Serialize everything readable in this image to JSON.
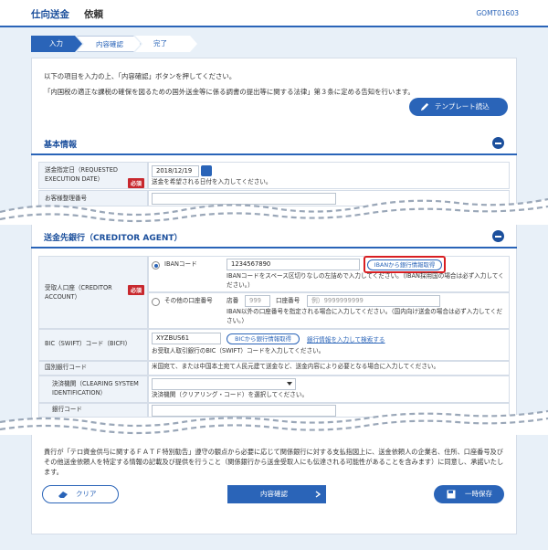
{
  "header": {
    "title": "仕向送金",
    "subtitle": "依頼",
    "screen_code": "GOMT01603"
  },
  "steps": [
    "入力",
    "内容確認",
    "完了"
  ],
  "intro": {
    "line1": "以下の項目を入力の上、「内容確認」ボタンを押してください。",
    "line2": "「内国税の適正な課税の確保を図るための国外送金等に係る調書の提出等に関する法律」第３条に定める告知を行います。"
  },
  "template_button": "テンプレート読込",
  "basic": {
    "title": "基本情報",
    "date_label": "送金指定日（REQUESTED EXECUTION DATE）",
    "required": "必須",
    "date_value": "2018/12/19",
    "date_note": "送金を希望される日付を入力してください。",
    "customer_ref_label": "お客様整理番号"
  },
  "creditor": {
    "title": "送金先銀行（CREDITOR AGENT）",
    "account_label": "受取人口座（CREDITOR ACCOUNT）",
    "required": "必須",
    "iban_radio": "IBANコード",
    "iban_value": "1234567890",
    "iban_lookup": "IBANから銀行情報取得",
    "iban_note": "IBANコードをスペース区切りなしの左詰めで入力してください。（IBAN採用国の場合は必ず入力してください。）",
    "other_radio": "その他の口座番号",
    "branch_label": "店番",
    "branch_placeholder": "999",
    "account_no_label": "口座番号",
    "account_no_placeholder": "例）9999999999",
    "other_note": "IBAN以外の口座番号を指定される場合に入力してください。（国内向け送金の場合は必ず入力してください。）",
    "bic_label": "BIC（SWIFT）コード（BICFI）",
    "bic_value": "XYZBUS61",
    "bic_lookup": "BICから銀行情報取得",
    "bic_search": "銀行情報を入力して検索する",
    "bic_note": "お受取人取引銀行のBIC（SWIFT）コードを入力してください。",
    "domestic_label": "国別銀行コード",
    "domestic_note": "米国宛て、または中国本土宛て人民元建て送金など、送金内容により必要となる場合に入力してください。",
    "clearing_label": "決済機関（CLEARING SYSTEM IDENTIFICATION）",
    "clearing_note": "決済機関（クリアリング・コード）を選択してください。",
    "bank_code_label": "銀行コード"
  },
  "footer": {
    "notice": "貴行が「テロ資金供与に関するＦＡＴＦ特別勧告」遵守の観点から必要に応じて関係銀行に対する支払指図上に、送金依頼人の企業名、住所、口座番号及びその他送金依頼人を特定する情報の記載及び提供を行うこと（関係銀行から送金受取人にも伝達される可能性があることを含みます）に同意し、承諾いたします。",
    "clear_button": "クリア",
    "confirm_button": "内容確認",
    "save_button": "一時保存"
  },
  "colors": {
    "primary": "#2a64b8",
    "required": "#c8282e",
    "highlight": "#d81e22"
  }
}
